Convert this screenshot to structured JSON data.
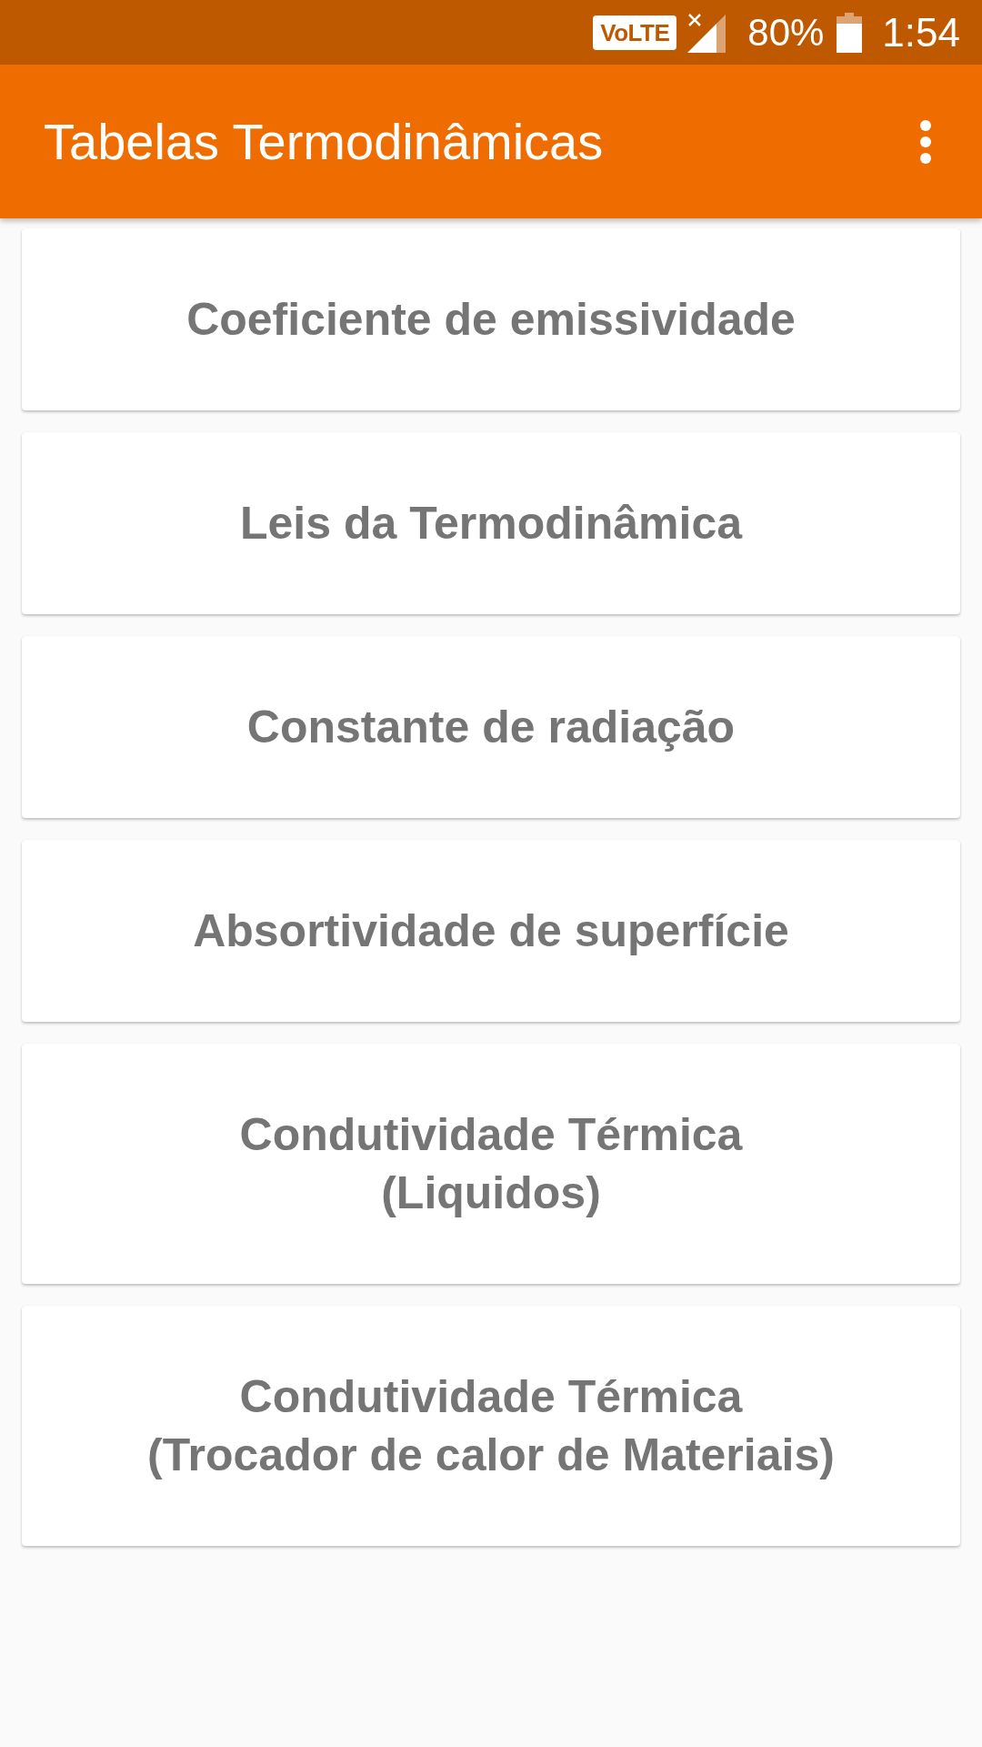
{
  "status_bar": {
    "network_badge": "VoLTE",
    "battery": "80%",
    "time": "1:54"
  },
  "app_bar": {
    "title": "Tabelas Termodinâmicas"
  },
  "items": [
    {
      "label": "Coeficiente de emissividade"
    },
    {
      "label": "Leis da Termodinâmica"
    },
    {
      "label": "Constante de radiação"
    },
    {
      "label": "Absortividade de superfície"
    },
    {
      "label": "Condutividade Térmica\n(Liquidos)"
    },
    {
      "label": "Condutividade Térmica\n(Trocador de calor de Materiais)"
    }
  ]
}
